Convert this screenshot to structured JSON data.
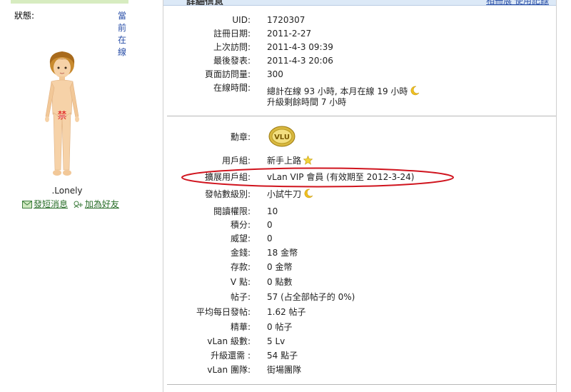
{
  "sidebar": {
    "status_label": "狀態:",
    "status_value": "當前在線",
    "username": ".Lonely",
    "avatar_mark": "禁",
    "send_message": "發短消息",
    "add_friend": "加為好友"
  },
  "main": {
    "title": "詳細信息",
    "header_links": "相冊展 使用記錄",
    "info_rows": [
      {
        "label": "UID:",
        "value": "1720307"
      },
      {
        "label": "註冊日期:",
        "value": "2011-2-27"
      },
      {
        "label": "上次訪問:",
        "value": "2011-4-3 09:39"
      },
      {
        "label": "最後發表:",
        "value": "2011-4-3 20:06"
      },
      {
        "label": "頁面訪問量:",
        "value": "300"
      },
      {
        "label": "在線時間:",
        "value": "總計在線 93 小時, 本月在線 19 小時",
        "value2": "升級剩餘時間 7 小時"
      }
    ],
    "group_rows": [
      {
        "label": "勳章:",
        "value": ""
      },
      {
        "label": "用戶組:",
        "value": "新手上路"
      },
      {
        "label": "擴展用戶組:",
        "value": "vLan VIP 會員 (有效期至 2012-3-24)"
      },
      {
        "label": "發帖數級別:",
        "value": "小試牛刀"
      },
      {
        "label": "閱讀權限:",
        "value": "10"
      },
      {
        "label": "積分:",
        "value": "0"
      },
      {
        "label": "威望:",
        "value": "0"
      },
      {
        "label": "金錢:",
        "value": "18 金幣"
      },
      {
        "label": "存款:",
        "value": "0 金幣"
      },
      {
        "label": "V 點:",
        "value": "0 點數"
      },
      {
        "label": "帖子:",
        "value": "57 (占全部帖子的 0%)"
      },
      {
        "label": "平均每日發帖:",
        "value": "1.62 帖子"
      },
      {
        "label": "精華:",
        "value": "0 帖子"
      },
      {
        "label": "vLan 級數:",
        "value": "5 Lv"
      },
      {
        "label": "升級還需 :",
        "value": "54 點子"
      },
      {
        "label": "vLan 團隊:",
        "value": "街場團隊"
      }
    ],
    "medal_text": "VLU"
  },
  "colors": {
    "link": "#2a4fa8",
    "green_link": "#2a6f2a",
    "highlight_ellipse": "#d0141e",
    "header_bg": "#dce9f7"
  }
}
